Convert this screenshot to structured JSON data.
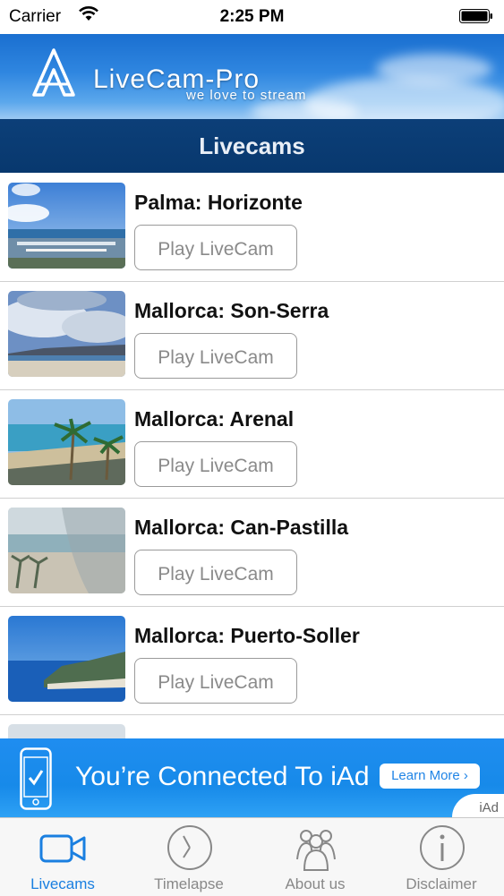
{
  "status_bar": {
    "carrier": "Carrier",
    "time": "2:25 PM"
  },
  "banner": {
    "brand": "LiveCam-Pro",
    "tagline": "we love to stream"
  },
  "nav": {
    "title": "Livecams"
  },
  "livecams": [
    {
      "name": "Palma: Horizonte",
      "button": "Play LiveCam"
    },
    {
      "name": "Mallorca: Son-Serra",
      "button": "Play LiveCam"
    },
    {
      "name": "Mallorca: Arenal",
      "button": "Play LiveCam"
    },
    {
      "name": "Mallorca: Can-Pastilla",
      "button": "Play LiveCam"
    },
    {
      "name": "Mallorca: Puerto-Soller",
      "button": "Play LiveCam"
    }
  ],
  "ad": {
    "text": "You’re Connected To iAd",
    "button": "Learn More ›",
    "tag": "iAd"
  },
  "tabs": [
    {
      "label": "Livecams",
      "icon": "video-camera-icon",
      "active": true
    },
    {
      "label": "Timelapse",
      "icon": "clock-icon",
      "active": false
    },
    {
      "label": "About us",
      "icon": "people-icon",
      "active": false
    },
    {
      "label": "Disclaimer",
      "icon": "info-icon",
      "active": false
    }
  ],
  "colors": {
    "nav_bg": "#0c3f78",
    "tab_active": "#1a7fe0",
    "ad_bg": "#1f8df0"
  }
}
